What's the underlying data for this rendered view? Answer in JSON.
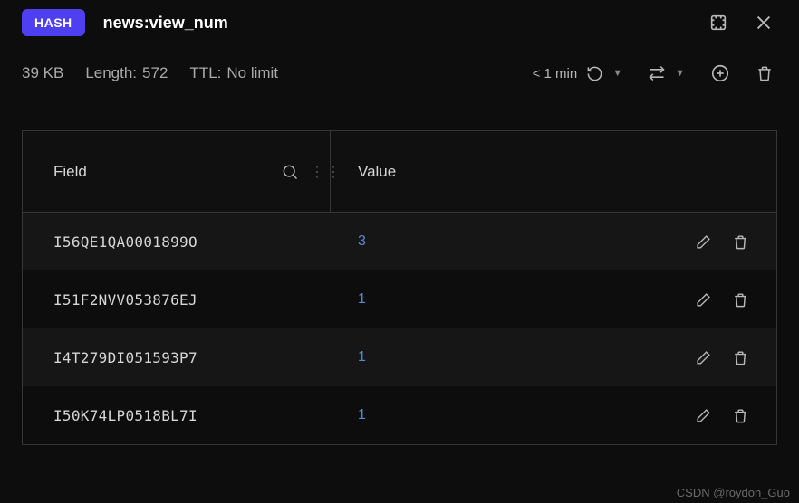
{
  "header": {
    "badge": "HASH",
    "key_name": "news:view_num"
  },
  "meta": {
    "size": "39 KB",
    "length_label": "Length:",
    "length_value": "572",
    "ttl_label": "TTL:",
    "ttl_value": "No limit",
    "refresh_age": "< 1 min"
  },
  "table": {
    "field_header": "Field",
    "value_header": "Value",
    "rows": [
      {
        "field": "I56QE1QA0001899O",
        "value": "3"
      },
      {
        "field": "I51F2NVV053876EJ",
        "value": "1"
      },
      {
        "field": "I4T279DI051593P7",
        "value": "1"
      },
      {
        "field": "I50K74LP0518BL7I",
        "value": "1"
      }
    ]
  },
  "watermark": "CSDN @roydon_Guo"
}
